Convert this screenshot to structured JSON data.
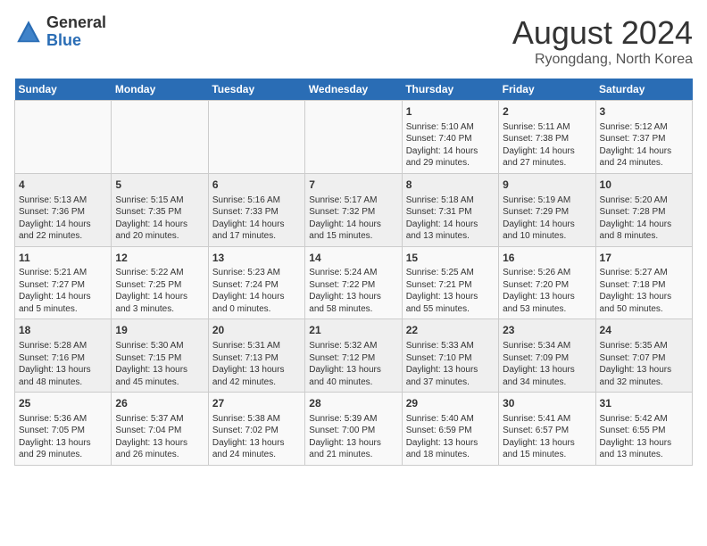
{
  "header": {
    "logo_general": "General",
    "logo_blue": "Blue",
    "month_year": "August 2024",
    "location": "Ryongdang, North Korea"
  },
  "weekdays": [
    "Sunday",
    "Monday",
    "Tuesday",
    "Wednesday",
    "Thursday",
    "Friday",
    "Saturday"
  ],
  "weeks": [
    [
      {
        "day": "",
        "info": ""
      },
      {
        "day": "",
        "info": ""
      },
      {
        "day": "",
        "info": ""
      },
      {
        "day": "",
        "info": ""
      },
      {
        "day": "1",
        "info": "Sunrise: 5:10 AM\nSunset: 7:40 PM\nDaylight: 14 hours\nand 29 minutes."
      },
      {
        "day": "2",
        "info": "Sunrise: 5:11 AM\nSunset: 7:38 PM\nDaylight: 14 hours\nand 27 minutes."
      },
      {
        "day": "3",
        "info": "Sunrise: 5:12 AM\nSunset: 7:37 PM\nDaylight: 14 hours\nand 24 minutes."
      }
    ],
    [
      {
        "day": "4",
        "info": "Sunrise: 5:13 AM\nSunset: 7:36 PM\nDaylight: 14 hours\nand 22 minutes."
      },
      {
        "day": "5",
        "info": "Sunrise: 5:15 AM\nSunset: 7:35 PM\nDaylight: 14 hours\nand 20 minutes."
      },
      {
        "day": "6",
        "info": "Sunrise: 5:16 AM\nSunset: 7:33 PM\nDaylight: 14 hours\nand 17 minutes."
      },
      {
        "day": "7",
        "info": "Sunrise: 5:17 AM\nSunset: 7:32 PM\nDaylight: 14 hours\nand 15 minutes."
      },
      {
        "day": "8",
        "info": "Sunrise: 5:18 AM\nSunset: 7:31 PM\nDaylight: 14 hours\nand 13 minutes."
      },
      {
        "day": "9",
        "info": "Sunrise: 5:19 AM\nSunset: 7:29 PM\nDaylight: 14 hours\nand 10 minutes."
      },
      {
        "day": "10",
        "info": "Sunrise: 5:20 AM\nSunset: 7:28 PM\nDaylight: 14 hours\nand 8 minutes."
      }
    ],
    [
      {
        "day": "11",
        "info": "Sunrise: 5:21 AM\nSunset: 7:27 PM\nDaylight: 14 hours\nand 5 minutes."
      },
      {
        "day": "12",
        "info": "Sunrise: 5:22 AM\nSunset: 7:25 PM\nDaylight: 14 hours\nand 3 minutes."
      },
      {
        "day": "13",
        "info": "Sunrise: 5:23 AM\nSunset: 7:24 PM\nDaylight: 14 hours\nand 0 minutes."
      },
      {
        "day": "14",
        "info": "Sunrise: 5:24 AM\nSunset: 7:22 PM\nDaylight: 13 hours\nand 58 minutes."
      },
      {
        "day": "15",
        "info": "Sunrise: 5:25 AM\nSunset: 7:21 PM\nDaylight: 13 hours\nand 55 minutes."
      },
      {
        "day": "16",
        "info": "Sunrise: 5:26 AM\nSunset: 7:20 PM\nDaylight: 13 hours\nand 53 minutes."
      },
      {
        "day": "17",
        "info": "Sunrise: 5:27 AM\nSunset: 7:18 PM\nDaylight: 13 hours\nand 50 minutes."
      }
    ],
    [
      {
        "day": "18",
        "info": "Sunrise: 5:28 AM\nSunset: 7:16 PM\nDaylight: 13 hours\nand 48 minutes."
      },
      {
        "day": "19",
        "info": "Sunrise: 5:30 AM\nSunset: 7:15 PM\nDaylight: 13 hours\nand 45 minutes."
      },
      {
        "day": "20",
        "info": "Sunrise: 5:31 AM\nSunset: 7:13 PM\nDaylight: 13 hours\nand 42 minutes."
      },
      {
        "day": "21",
        "info": "Sunrise: 5:32 AM\nSunset: 7:12 PM\nDaylight: 13 hours\nand 40 minutes."
      },
      {
        "day": "22",
        "info": "Sunrise: 5:33 AM\nSunset: 7:10 PM\nDaylight: 13 hours\nand 37 minutes."
      },
      {
        "day": "23",
        "info": "Sunrise: 5:34 AM\nSunset: 7:09 PM\nDaylight: 13 hours\nand 34 minutes."
      },
      {
        "day": "24",
        "info": "Sunrise: 5:35 AM\nSunset: 7:07 PM\nDaylight: 13 hours\nand 32 minutes."
      }
    ],
    [
      {
        "day": "25",
        "info": "Sunrise: 5:36 AM\nSunset: 7:05 PM\nDaylight: 13 hours\nand 29 minutes."
      },
      {
        "day": "26",
        "info": "Sunrise: 5:37 AM\nSunset: 7:04 PM\nDaylight: 13 hours\nand 26 minutes."
      },
      {
        "day": "27",
        "info": "Sunrise: 5:38 AM\nSunset: 7:02 PM\nDaylight: 13 hours\nand 24 minutes."
      },
      {
        "day": "28",
        "info": "Sunrise: 5:39 AM\nSunset: 7:00 PM\nDaylight: 13 hours\nand 21 minutes."
      },
      {
        "day": "29",
        "info": "Sunrise: 5:40 AM\nSunset: 6:59 PM\nDaylight: 13 hours\nand 18 minutes."
      },
      {
        "day": "30",
        "info": "Sunrise: 5:41 AM\nSunset: 6:57 PM\nDaylight: 13 hours\nand 15 minutes."
      },
      {
        "day": "31",
        "info": "Sunrise: 5:42 AM\nSunset: 6:55 PM\nDaylight: 13 hours\nand 13 minutes."
      }
    ]
  ]
}
